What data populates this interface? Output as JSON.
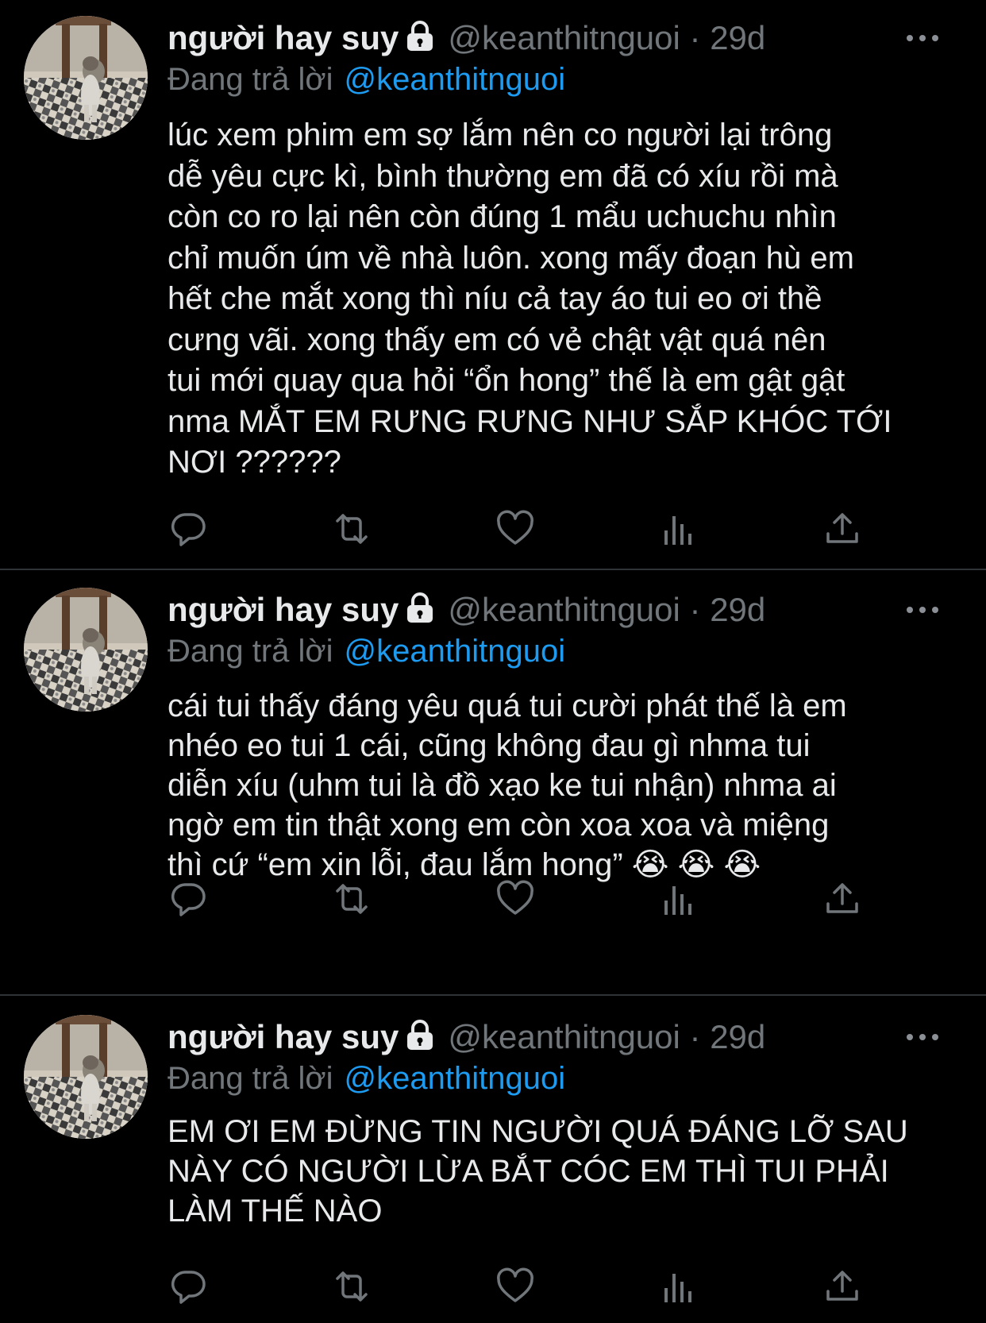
{
  "tweets": [
    {
      "display_name": "người hay suy",
      "handle": "@keanthitnguoi",
      "separator": "·",
      "time": "29d",
      "replying_label": "Đang trả lời",
      "replying_to": "@keanthitnguoi",
      "text": "lúc xem phim em sợ lắm nên co người lại trông\ndễ yêu cực kì, bình thường em đã có xíu rồi mà\ncòn co ro lại nên còn đúng 1 mẩu uchuchu nhìn\nchỉ muốn úm về nhà luôn. xong mấy đoạn hù em\nhết che mắt xong thì níu cả tay áo tui eo ơi thề\ncưng vãi. xong thấy em có vẻ chật vật quá nên\ntui mới quay qua hỏi “ổn hong” thế là em gật gật\nnma MẮT EM RƯNG RƯNG NHƯ SẮP KHÓC TỚI\nNƠI ??????"
    },
    {
      "display_name": "người hay suy",
      "handle": "@keanthitnguoi",
      "separator": "·",
      "time": "29d",
      "replying_label": "Đang trả lời",
      "replying_to": "@keanthitnguoi",
      "text": "cái tui thấy đáng yêu quá tui cười phát thế là em\nnhéo eo tui 1 cái, cũng không đau gì nhma tui\ndiễn xíu (uhm tui là đồ xạo ke tui nhận) nhma ai\nngờ em tin thật xong em còn xoa xoa và miệng\nthì cứ “em xin lỗi, đau lắm hong” 😭 😭 😭"
    },
    {
      "display_name": "người hay suy",
      "handle": "@keanthitnguoi",
      "separator": "·",
      "time": "29d",
      "replying_label": "Đang trả lời",
      "replying_to": "@keanthitnguoi",
      "text": "EM ƠI EM ĐỪNG TIN NGƯỜI QUÁ ĐÁNG LỠ SAU\nNÀY CÓ NGƯỜI LỪA BẮT CÓC EM THÌ TUI PHẢI\nLÀM THẾ NÀO"
    }
  ],
  "icons": {
    "reply": "reply-icon",
    "retweet": "retweet-icon",
    "like": "heart-icon",
    "analytics": "analytics-icon",
    "share": "share-icon",
    "lock": "lock-icon",
    "more": "more-icon"
  },
  "colors": {
    "background": "#000000",
    "text": "#e7e9ea",
    "muted": "#71767b",
    "link": "#1d9bf0",
    "divider": "#2f3336"
  }
}
